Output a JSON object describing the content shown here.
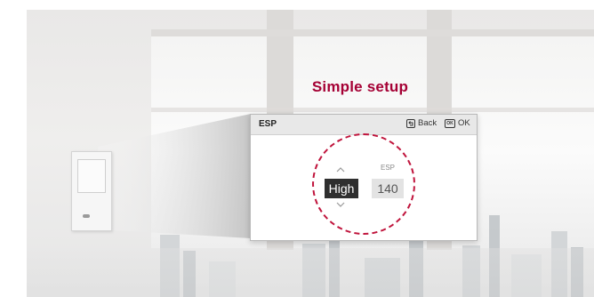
{
  "title": "Simple setup",
  "panel": {
    "title": "ESP",
    "back_label": "Back",
    "ok_icon_text": "OK",
    "ok_label": "OK"
  },
  "setting": {
    "mode_value": "High",
    "esp_label": "ESP",
    "esp_value": "140"
  },
  "icons": [
    "back-icon",
    "ok-icon",
    "chevron-up-icon",
    "chevron-down-icon"
  ],
  "colors": {
    "accent": "#a50034",
    "highlight_circle": "#c0143c",
    "selected_bg": "#2f2f2f"
  }
}
